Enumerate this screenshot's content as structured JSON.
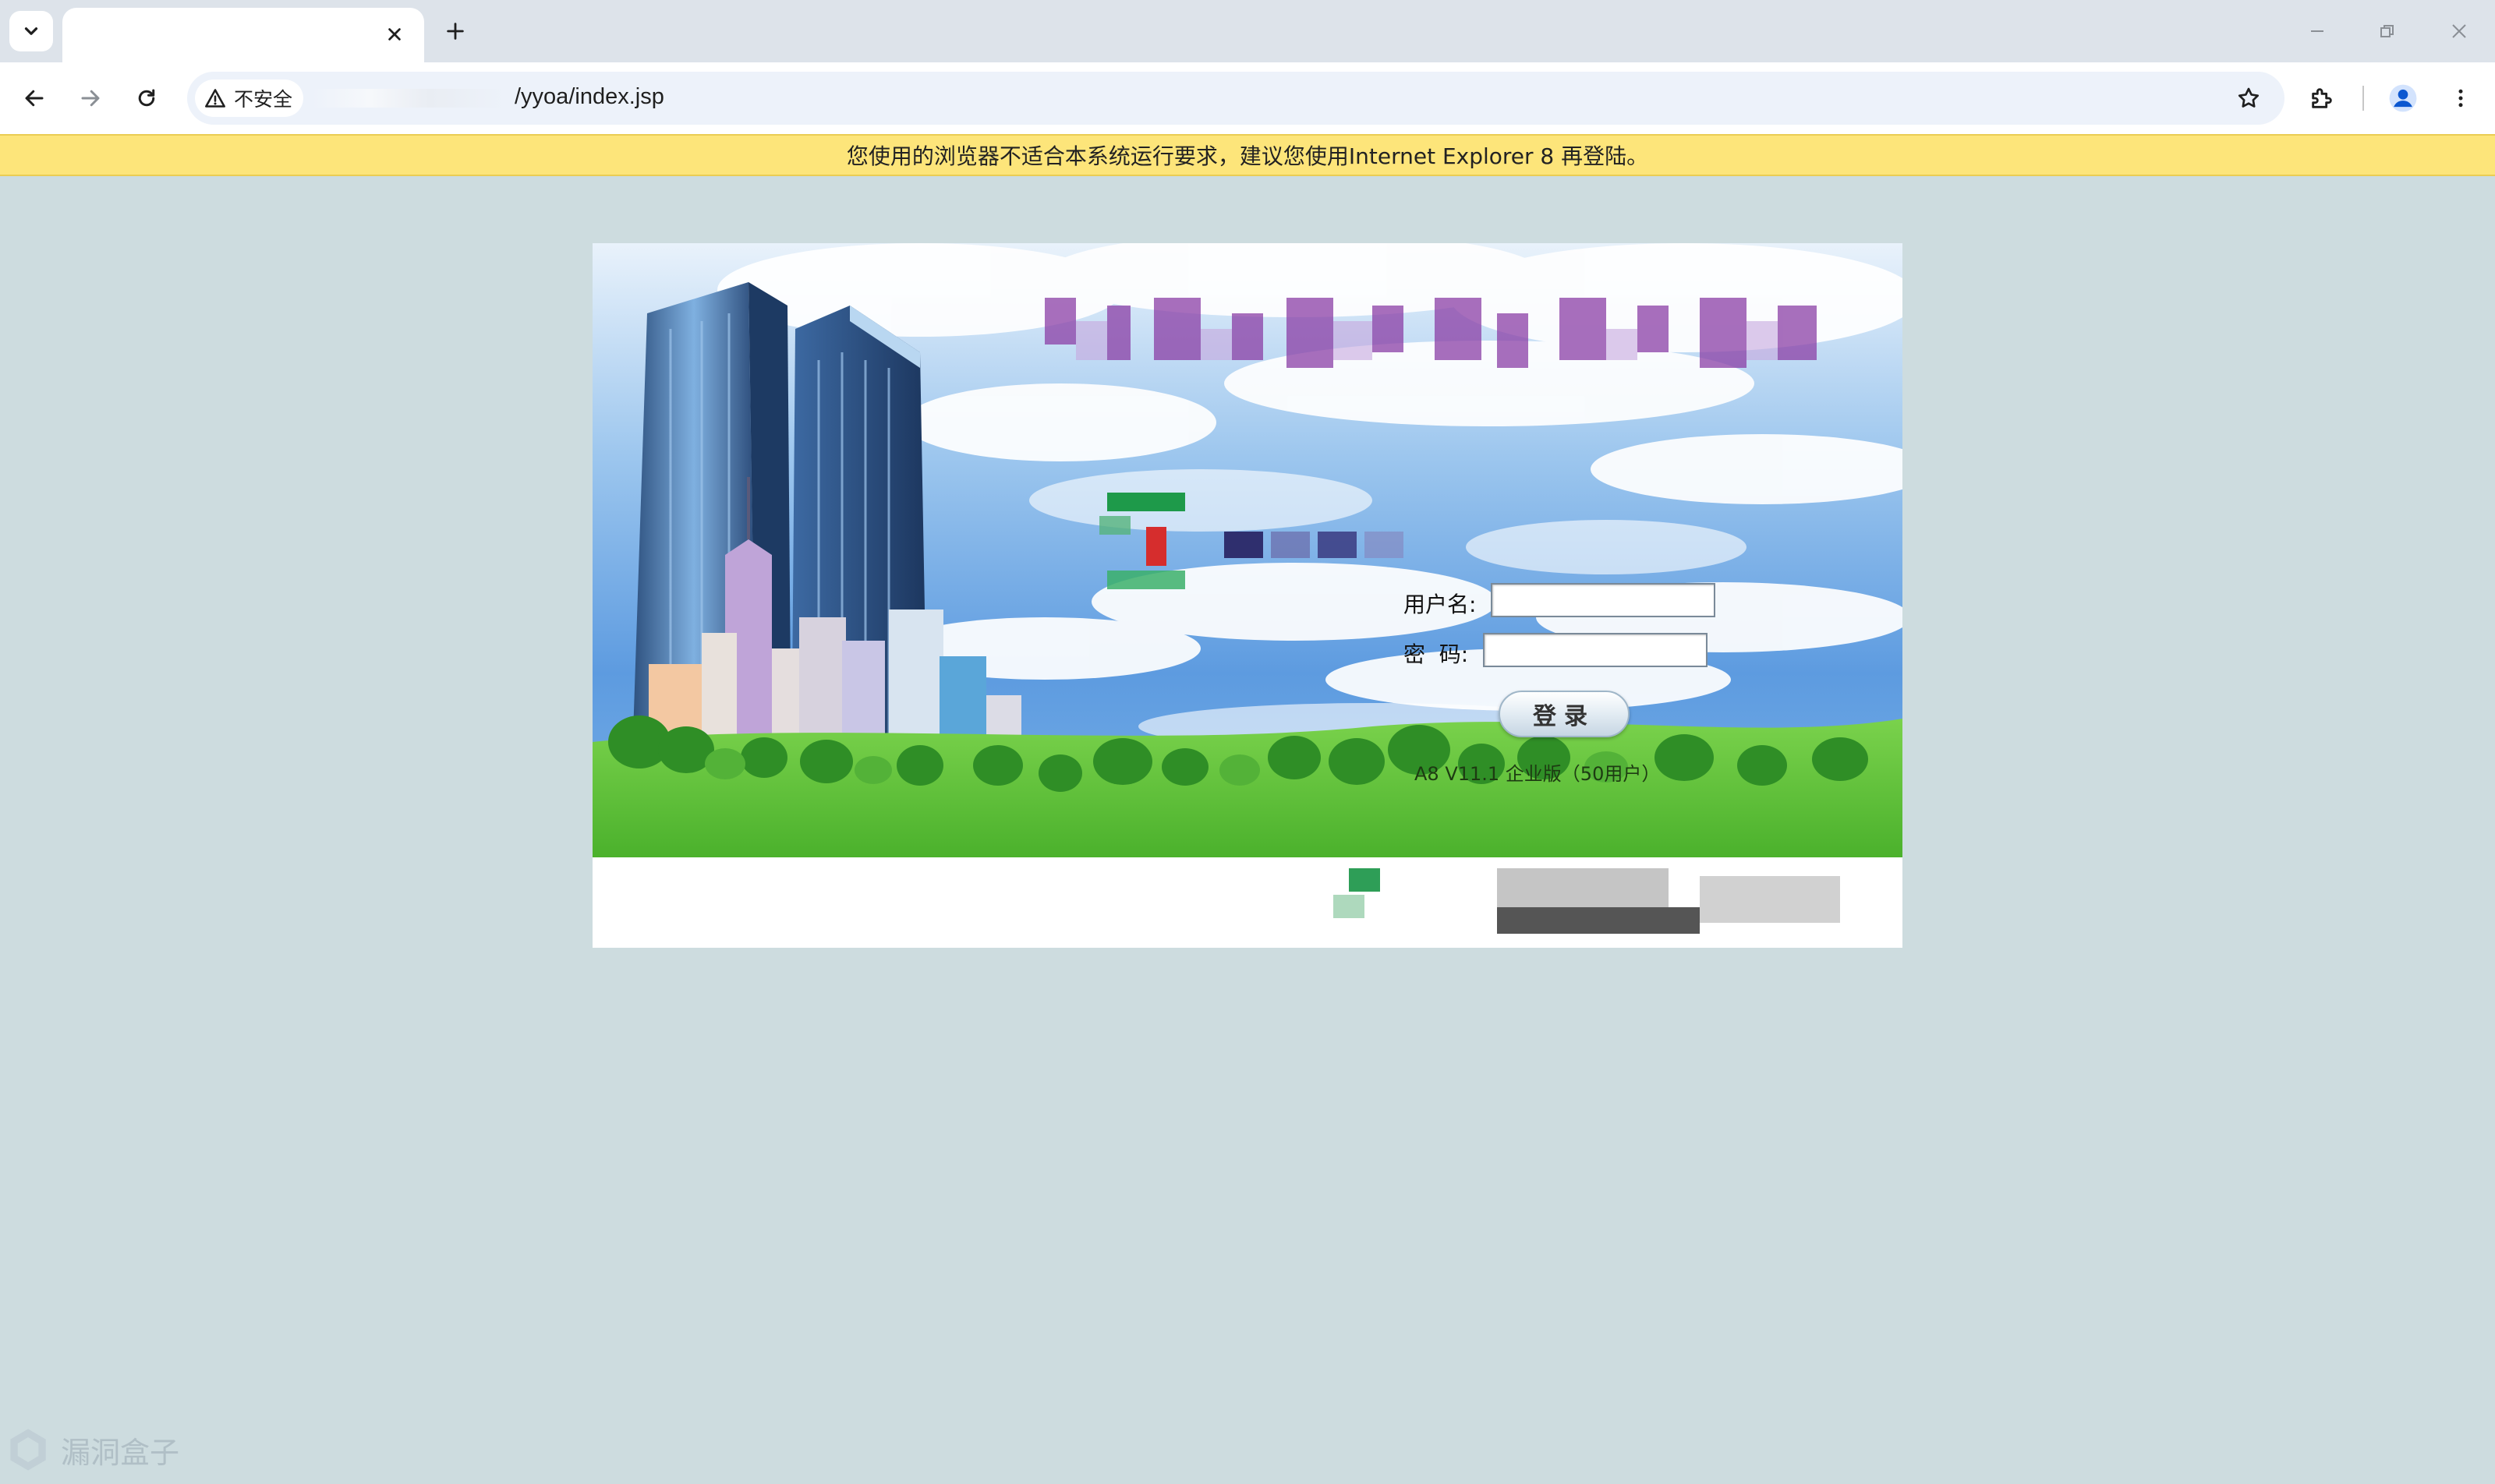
{
  "browser": {
    "tab_title": "",
    "url_path": "/yyoa/index.jsp",
    "security_label": "不安全"
  },
  "warning_bar": {
    "text": "您使用的浏览器不适合本系统运行要求，建议您使用Internet Explorer 8 再登陆。"
  },
  "login": {
    "username_label": "用户名:",
    "password_label": "密  码:",
    "username_value": "",
    "password_value": "",
    "submit_label": "登录",
    "install_link": "",
    "version_text": "A8 V11.1 企业版（50用户）"
  },
  "watermark": {
    "text": "漏洞盒子"
  },
  "colors": {
    "page_background": "#cddcdf",
    "warning_background": "#fde57a",
    "sky": "#5d9be0",
    "grass": "#5cc13a"
  },
  "icons": {
    "tab_search": "chevron-down-icon",
    "close": "close-icon",
    "new_tab": "plus-icon",
    "back": "arrow-left-icon",
    "forward": "arrow-right-icon",
    "reload": "reload-icon",
    "warning": "warning-triangle-icon",
    "bookmark": "star-icon",
    "extensions": "puzzle-icon",
    "profile": "person-icon",
    "menu": "kebab-menu-icon"
  }
}
